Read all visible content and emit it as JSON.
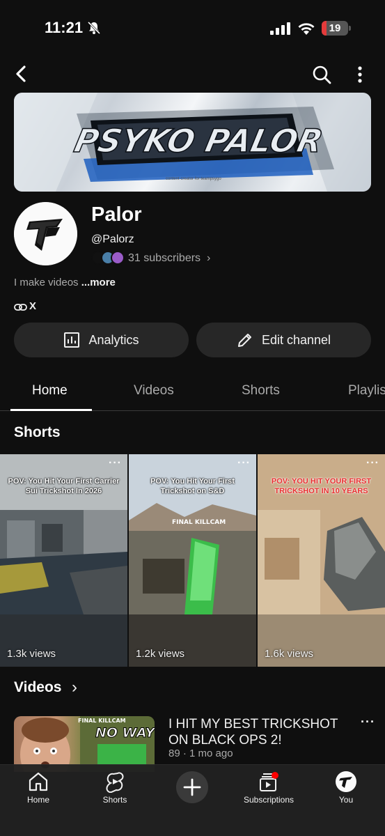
{
  "status_bar": {
    "time": "11:21",
    "battery": "19",
    "battery_level": 0.19
  },
  "channel": {
    "name": "Palor",
    "handle": "@Palorz",
    "subscribers": "31 subscribers",
    "description": "I make videos",
    "description_more": "...more",
    "link": "X",
    "banner_text": "PSYKO PALOR",
    "banner_tagline": "content creator for teampsygo"
  },
  "actions": {
    "analytics": "Analytics",
    "edit": "Edit channel"
  },
  "tabs": [
    {
      "label": "Home",
      "active": true
    },
    {
      "label": "Videos",
      "active": false
    },
    {
      "label": "Shorts",
      "active": false
    },
    {
      "label": "Playlis",
      "active": false
    }
  ],
  "shorts": {
    "title": "Shorts",
    "items": [
      {
        "caption": "POV: You Hit Your First Carrier Sui Trickshot In 2026",
        "views": "1.3k views"
      },
      {
        "caption": "POV: You Hit Your First Trickshot on S&D",
        "overlay": "FINAL KILLCAM",
        "views": "1.2k views"
      },
      {
        "caption": "POV: YOU HIT YOUR FIRST TRICKSHOT IN 10 YEARS",
        "views": "1.6k views"
      }
    ]
  },
  "videos": {
    "title": "Videos",
    "items": [
      {
        "title": "I HIT MY BEST TRICKSHOT ON BLACK OPS 2!",
        "meta": "89 · 1 mo ago",
        "thumb_text": "NO WAY!",
        "thumb_small": "FINAL KILLCAM"
      }
    ]
  },
  "nav": {
    "home": "Home",
    "shorts": "Shorts",
    "subscriptions": "Subscriptions",
    "you": "You"
  },
  "colors": {
    "background": "#0f0f0f",
    "button": "#272727",
    "notification": "#ff0000"
  }
}
